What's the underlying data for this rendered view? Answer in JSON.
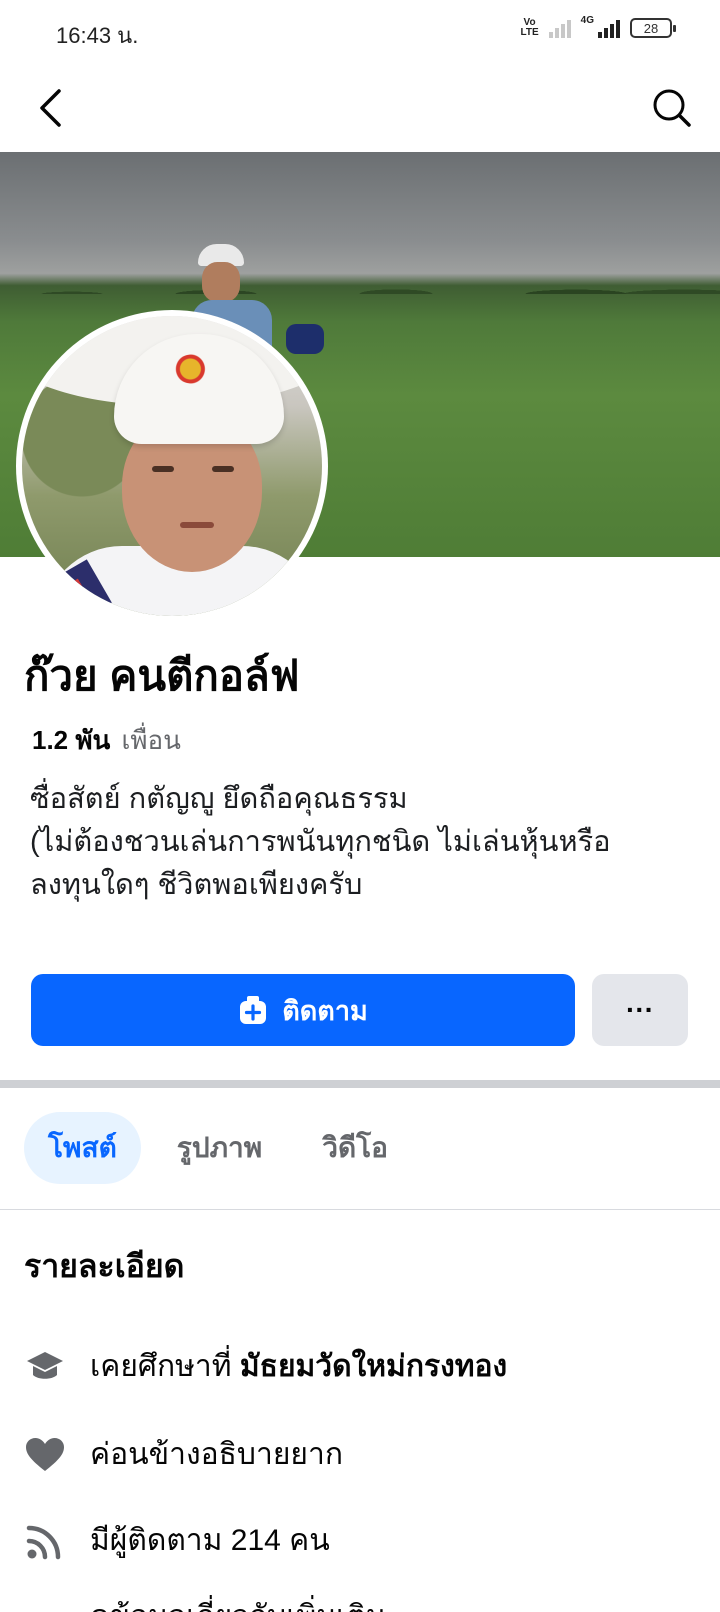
{
  "status_bar": {
    "time": "16:43 น.",
    "network": "4G",
    "volte": "Vo LTE",
    "battery": "28"
  },
  "app_bar": {
    "back_icon": "chevron-left-icon",
    "search_icon": "search-icon"
  },
  "profile": {
    "name": "ก๊วย คนตีกอล์ฟ",
    "friends_count": "1.2 พัน",
    "friends_label": "เพื่อน",
    "bio_line1": "ซื่อสัตย์ กตัญญู ยึดถือคุณธรรม",
    "bio_line2": "(ไม่ต้องชวนเล่นการพนันทุกชนิด ไม่เล่นหุ้นหรือ",
    "bio_line3": "ลงทุนใดๆ ชีวิตพอเพียงครับ"
  },
  "actions": {
    "follow_label": "ติดตาม",
    "follow_icon": "follow-plus-icon",
    "more_label": "···",
    "primary_color": "#0866ff"
  },
  "tabs": [
    {
      "label": "โพสต์",
      "active": true
    },
    {
      "label": "รูปภาพ",
      "active": false
    },
    {
      "label": "วิดีโอ",
      "active": false
    }
  ],
  "details": {
    "title": "รายละเอียด",
    "education_prefix": "เคยศึกษาที่",
    "education_school": "มัธยมวัดใหม่กรงทอง",
    "relationship": "ค่อนข้างอธิบายยาก",
    "followers": "มีผู้ติดตาม 214 คน",
    "cut_off": "ดูข้อมูลเกี่ยวกับเพิ่มเติม"
  }
}
